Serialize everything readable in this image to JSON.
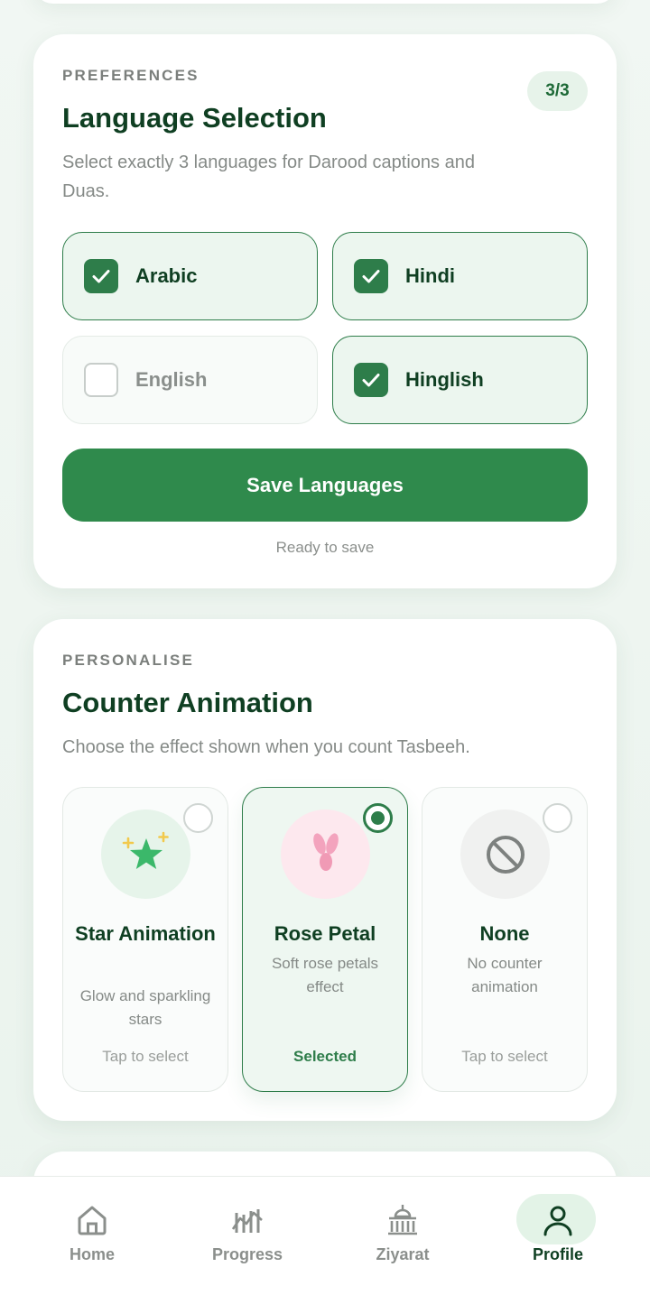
{
  "language_card": {
    "eyebrow": "PREFERENCES",
    "title": "Language Selection",
    "subtitle": "Select exactly 3 languages for Darood captions and Duas.",
    "count_badge": "3/3",
    "languages": [
      {
        "label": "Arabic",
        "checked": true
      },
      {
        "label": "Hindi",
        "checked": true
      },
      {
        "label": "English",
        "checked": false
      },
      {
        "label": "Hinglish",
        "checked": true
      }
    ],
    "save_button": "Save Languages",
    "status": "Ready to save"
  },
  "animation_card": {
    "eyebrow": "PERSONALISE",
    "title": "Counter Animation",
    "subtitle": "Choose the effect shown when you count Tasbeeh.",
    "options": [
      {
        "name": "Star Animation",
        "description": "Glow and sparkling stars",
        "status": "Tap to select",
        "icon": "star-icon",
        "selected": false
      },
      {
        "name": "Rose Petal",
        "description": "Soft rose petals effect",
        "status": "Selected",
        "icon": "rose-petal-icon",
        "selected": true
      },
      {
        "name": "None",
        "description": "No counter animation",
        "status": "Tap to select",
        "icon": "no-animation-icon",
        "selected": false
      }
    ]
  },
  "bottom_nav": {
    "items": [
      {
        "label": "Home",
        "icon": "home-icon"
      },
      {
        "label": "Progress",
        "icon": "progress-icon"
      },
      {
        "label": "Ziyarat",
        "icon": "mosque-icon"
      },
      {
        "label": "Profile",
        "icon": "profile-icon",
        "active": true
      }
    ]
  },
  "colors": {
    "primary": "#2f8a4c",
    "primary_dark": "#0f3f22",
    "accent_light": "#ecf6ef"
  }
}
